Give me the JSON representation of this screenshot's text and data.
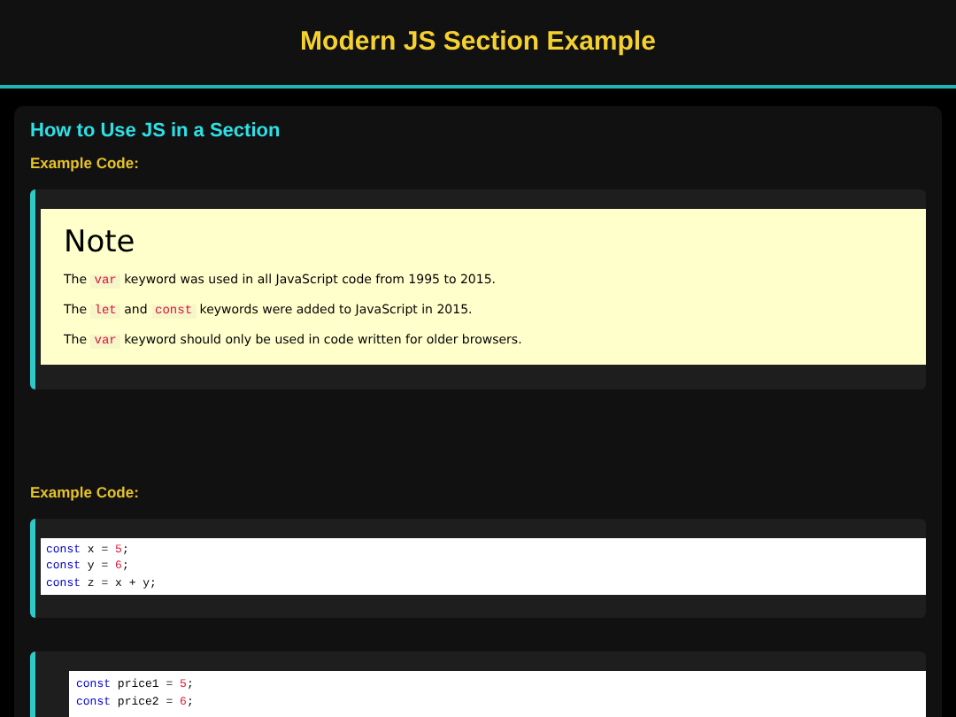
{
  "header": {
    "title": "Modern JS Section Example"
  },
  "section": {
    "heading": "How to Use JS in a Section",
    "blocks": [
      {
        "kind": "note",
        "label": "Example Code:",
        "title": "Note",
        "paragraphs": [
          [
            {
              "kind": "text",
              "text": "The"
            },
            {
              "kind": "code",
              "text": "var"
            },
            {
              "kind": "text",
              "text": "keyword was used in all JavaScript code from 1995 to 2015."
            }
          ],
          [
            {
              "kind": "text",
              "text": "The"
            },
            {
              "kind": "code",
              "text": "let"
            },
            {
              "kind": "text",
              "text": "and"
            },
            {
              "kind": "code",
              "text": "const"
            },
            {
              "kind": "text",
              "text": "keywords were added to JavaScript in 2015."
            }
          ],
          [
            {
              "kind": "text",
              "text": "The"
            },
            {
              "kind": "code",
              "text": "var"
            },
            {
              "kind": "text",
              "text": "keyword should only be used in code written for older browsers."
            }
          ]
        ]
      },
      {
        "kind": "code",
        "label": "Example Code:",
        "indented": false,
        "lines": [
          [
            {
              "kind": "keyword",
              "text": "const"
            },
            {
              "kind": "plain",
              "text": "x ="
            },
            {
              "kind": "number",
              "text": "5"
            },
            {
              "kind": "plain",
              "text": ";"
            }
          ],
          [
            {
              "kind": "keyword",
              "text": "const"
            },
            {
              "kind": "plain",
              "text": "y ="
            },
            {
              "kind": "number",
              "text": "6"
            },
            {
              "kind": "plain",
              "text": ";"
            }
          ],
          [
            {
              "kind": "keyword",
              "text": "const"
            },
            {
              "kind": "plain",
              "text": "z = x + y;"
            }
          ]
        ]
      },
      {
        "kind": "code",
        "indented": true,
        "lines": [
          [
            {
              "kind": "keyword",
              "text": "const"
            },
            {
              "kind": "plain",
              "text": "price1 ="
            },
            {
              "kind": "number",
              "text": "5"
            },
            {
              "kind": "plain",
              "text": ";"
            }
          ],
          [
            {
              "kind": "keyword",
              "text": "const"
            },
            {
              "kind": "plain",
              "text": "price2 ="
            },
            {
              "kind": "number",
              "text": "6"
            },
            {
              "kind": "plain",
              "text": ";"
            }
          ]
        ]
      }
    ]
  }
}
